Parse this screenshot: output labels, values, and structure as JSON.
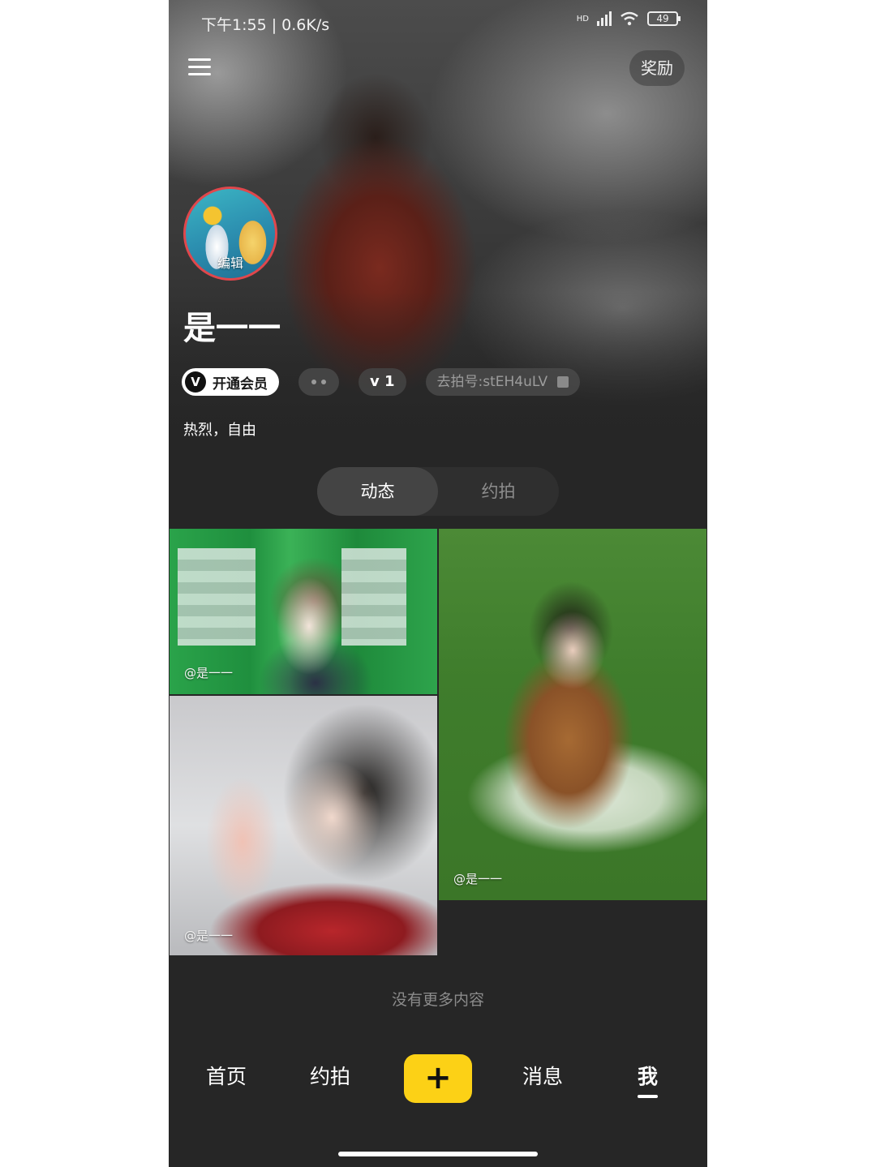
{
  "status_bar": {
    "time_speed": "下午1:55 | 0.6K/s",
    "network": "HD",
    "battery": "49"
  },
  "header": {
    "reward_label": "奖励",
    "avatar_edit_label": "编辑",
    "username": "是一一",
    "vip_icon": "V",
    "vip_label": "开通会员",
    "level_label": "v 1",
    "id_label": "去拍号:stEH4uLV",
    "bio": "热烈，自由"
  },
  "tabs": [
    {
      "label": "动态",
      "active": true
    },
    {
      "label": "约拍",
      "active": false
    }
  ],
  "photos": [
    {
      "caption": "@是一一"
    },
    {
      "caption": "@是一一"
    },
    {
      "caption": "@是一一"
    }
  ],
  "feed_end_text": "没有更多内容",
  "bottom_nav": {
    "home": "首页",
    "shoot": "约拍",
    "add": "+",
    "messages": "消息",
    "me": "我"
  },
  "colors": {
    "accent_yellow": "#fcd116",
    "avatar_border": "#e0474c",
    "background": "#262626"
  },
  "icons": [
    "menu-icon",
    "signal-icon",
    "wifi-icon",
    "battery-icon",
    "vip-icon",
    "copy-icon",
    "plus-icon"
  ]
}
